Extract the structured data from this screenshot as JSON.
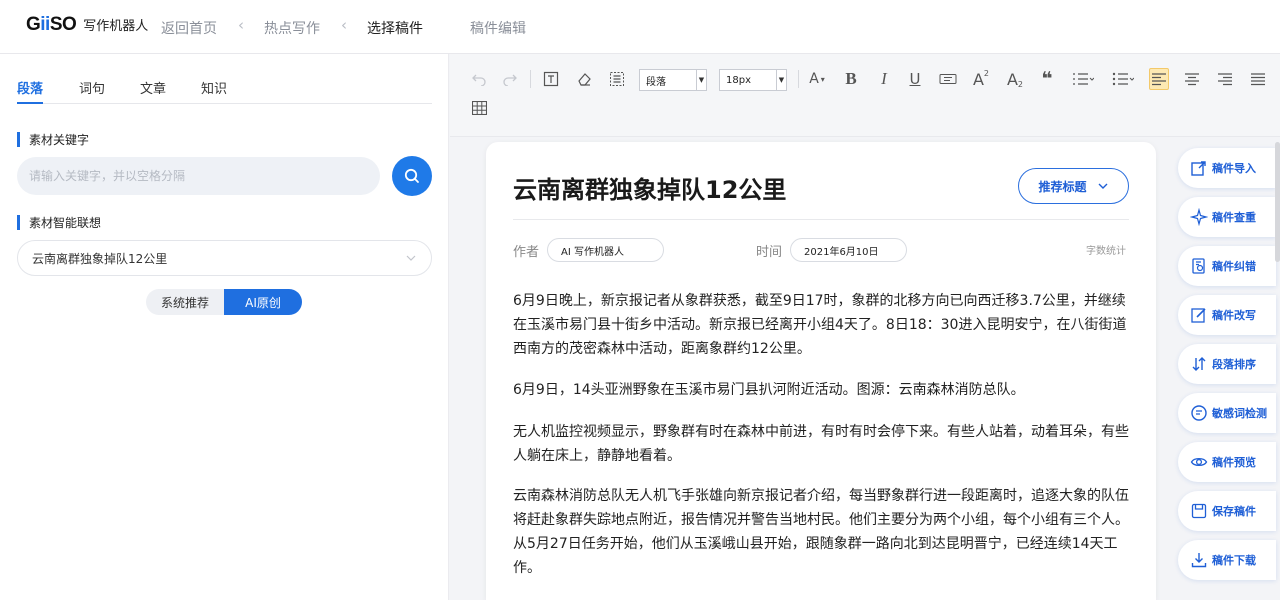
{
  "topnav": {
    "logo": {
      "part1": "G",
      "part2": "ii",
      "part3": "SO"
    },
    "logo_text": "写作机器人",
    "items": [
      "返回首页",
      "热点写作",
      "选择稿件",
      "稿件编辑"
    ]
  },
  "left": {
    "tabs": [
      "段落",
      "词句",
      "文章",
      "知识"
    ],
    "keyword_title": "素材关键字",
    "keyword_placeholder": "请输入关键字，并以空格分隔",
    "assoc_title": "素材智能联想",
    "assoc_value": "云南离群独象掉队12公里",
    "seg": {
      "system": "系统推荐",
      "ai": "AI原创"
    }
  },
  "toolbar": {
    "paragraph_select": "段落",
    "size_select": "18px"
  },
  "editor": {
    "title": "云南离群独象掉队12公里",
    "recommend_button": "推荐标题",
    "author_label": "作者",
    "author_value": "AI 写作机器人",
    "time_label": "时间",
    "time_value": "2021年6月10日",
    "wordcount_label": "字数统计",
    "paragraphs": [
      "6月9日晚上，新京报记者从象群获悉，截至9日17时，象群的北移方向已向西迁移3.7公里，并继续在玉溪市易门县十街乡中活动。新京报已经离开小组4天了。8日18：30进入昆明安宁，在八街街道西南方的茂密森林中活动，距离象群约12公里。",
      "6月9日，14头亚洲野象在玉溪市易门县扒河附近活动。图源：云南森林消防总队。",
      "无人机监控视频显示，野象群有时在森林中前进，有时有时会停下来。有些人站着，动着耳朵，有些人躺在床上，静静地看着。",
      "云南森林消防总队无人机飞手张雄向新京报记者介绍，每当野象群行进一段距离时，追逐大象的队伍将赶赴象群失踪地点附近，报告情况并警告当地村民。他们主要分为两个小组，每个小组有三个人。从5月27日任务开始，他们从玉溪峨山县开始，跟随象群一路向北到达昆明晋宁，已经连续14天工作。"
    ]
  },
  "actions": [
    {
      "label": "稿件导入",
      "icon": "import-icon"
    },
    {
      "label": "稿件查重",
      "icon": "duplicate-check-icon"
    },
    {
      "label": "稿件纠错",
      "icon": "proofread-icon"
    },
    {
      "label": "稿件改写",
      "icon": "rewrite-icon"
    },
    {
      "label": "段落排序",
      "icon": "sort-icon"
    },
    {
      "label": "敏感词检测",
      "icon": "sensitive-word-icon"
    },
    {
      "label": "稿件预览",
      "icon": "preview-icon"
    },
    {
      "label": "保存稿件",
      "icon": "save-icon"
    },
    {
      "label": "稿件下载",
      "icon": "download-icon"
    }
  ]
}
